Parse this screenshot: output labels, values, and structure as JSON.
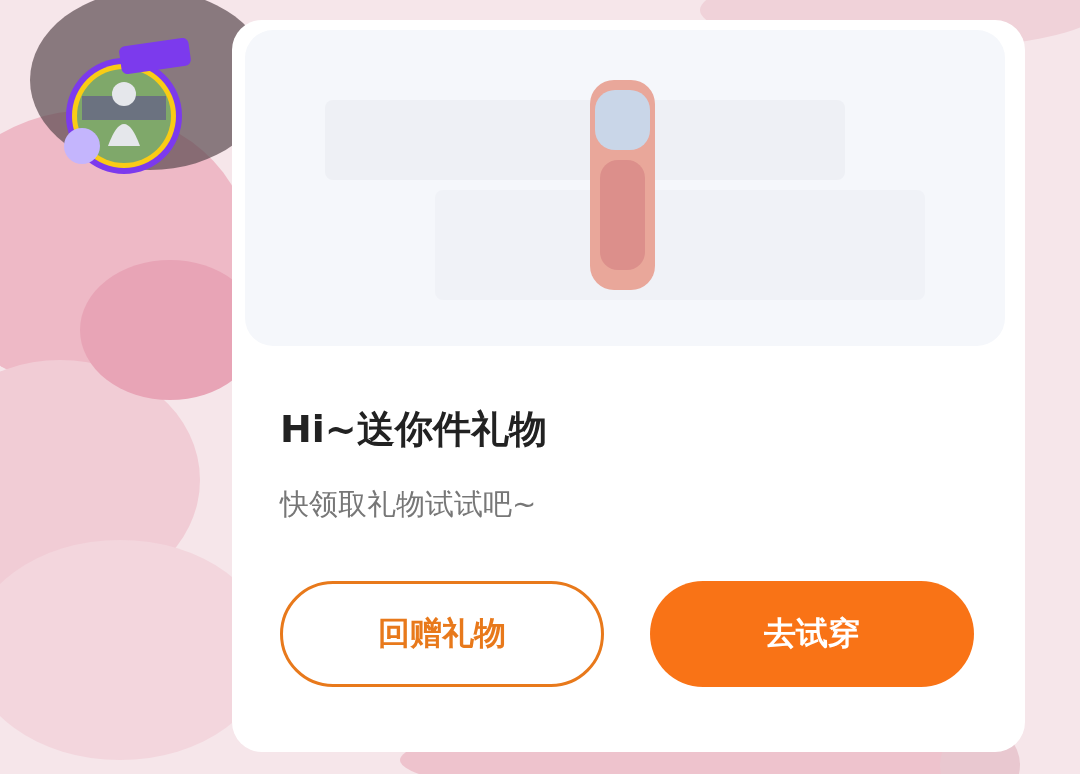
{
  "gift_card": {
    "title": "Hi~送你件礼物",
    "subtitle": "快领取礼物试试吧~",
    "buttons": [
      {
        "label": "回赠礼物",
        "kind": "outline"
      },
      {
        "label": "去试穿",
        "kind": "filled"
      }
    ]
  }
}
